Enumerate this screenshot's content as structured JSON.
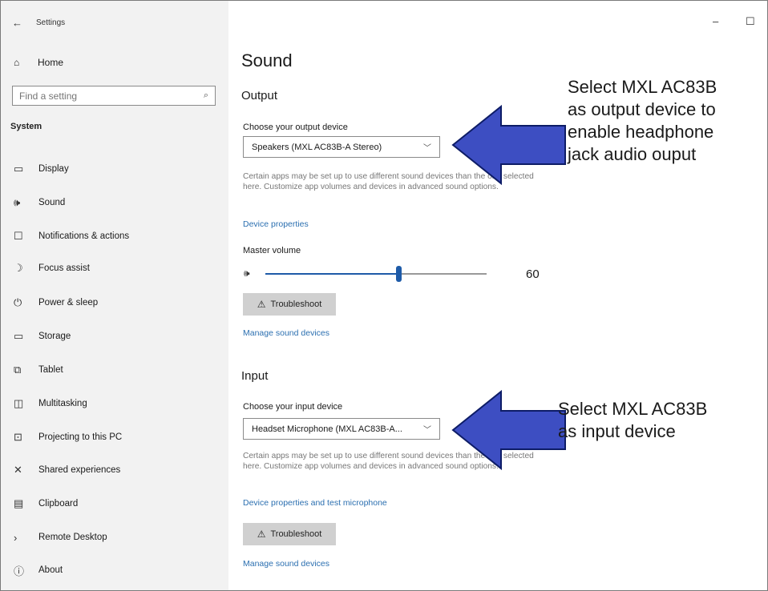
{
  "window": {
    "back_glyph": "←",
    "title": "Settings",
    "minimize_glyph": "–",
    "maximize_glyph": "☐"
  },
  "sidebar": {
    "home": {
      "icon": "home-icon",
      "glyph": "⌂",
      "label": "Home"
    },
    "search": {
      "placeholder": "Find a setting",
      "icon": "search-icon",
      "glyph": "⌕"
    },
    "section_title": "System",
    "items": [
      {
        "icon": "display-icon",
        "glyph": "▭",
        "label": "Display"
      },
      {
        "icon": "speaker-icon",
        "glyph": "🕪",
        "label": "Sound"
      },
      {
        "icon": "notifications-icon",
        "glyph": "☐",
        "label": "Notifications & actions"
      },
      {
        "icon": "focus-assist-icon",
        "glyph": "☽",
        "label": "Focus assist"
      },
      {
        "icon": "power-icon",
        "glyph": "⏻",
        "label": "Power & sleep"
      },
      {
        "icon": "storage-icon",
        "glyph": "▭",
        "label": "Storage"
      },
      {
        "icon": "tablet-icon",
        "glyph": "⧉",
        "label": "Tablet"
      },
      {
        "icon": "multitasking-icon",
        "glyph": "◫",
        "label": "Multitasking"
      },
      {
        "icon": "projecting-icon",
        "glyph": "⊡",
        "label": "Projecting to this PC"
      },
      {
        "icon": "shared-experiences-icon",
        "glyph": "✕",
        "label": "Shared experiences"
      },
      {
        "icon": "clipboard-icon",
        "glyph": "▤",
        "label": "Clipboard"
      },
      {
        "icon": "remote-desktop-icon",
        "glyph": "›",
        "label": "Remote Desktop"
      },
      {
        "icon": "about-icon",
        "glyph": "ⓘ",
        "label": "About"
      }
    ]
  },
  "main": {
    "title": "Sound",
    "output": {
      "heading": "Output",
      "device_label": "Choose your output device",
      "device_value": "Speakers (MXL AC83B-A Stereo)",
      "description": "Certain apps may be set up to use different sound devices than the one selected here. Customize app volumes and devices in advanced sound options.",
      "device_properties_link": "Device properties",
      "master_volume_label": "Master volume",
      "volume_value": "60",
      "volume_fraction": 0.6,
      "troubleshoot_label": "Troubleshoot",
      "manage_link": "Manage sound devices"
    },
    "input": {
      "heading": "Input",
      "device_label": "Choose your input device",
      "device_value": "Headset Microphone (MXL AC83B-A...",
      "description": "Certain apps may be set up to use different sound devices than the one selected here. Customize app volumes and devices in advanced sound options.",
      "device_properties_link": "Device properties and test microphone",
      "troubleshoot_label": "Troubleshoot",
      "manage_link": "Manage sound devices"
    }
  },
  "annotations": {
    "output_note": [
      "Select MXL AC83B",
      "as output device to",
      "enable headphone",
      "jack audio ouput"
    ],
    "input_note": [
      "Select MXL AC83B",
      "as input device"
    ],
    "arrow_color": "#3d4ec2",
    "arrow_outline": "#0d1c66"
  },
  "colors": {
    "sidebar_bg": "#f2f2f2",
    "link": "#2b6fb0",
    "slider_accent": "#1e5ba8"
  }
}
